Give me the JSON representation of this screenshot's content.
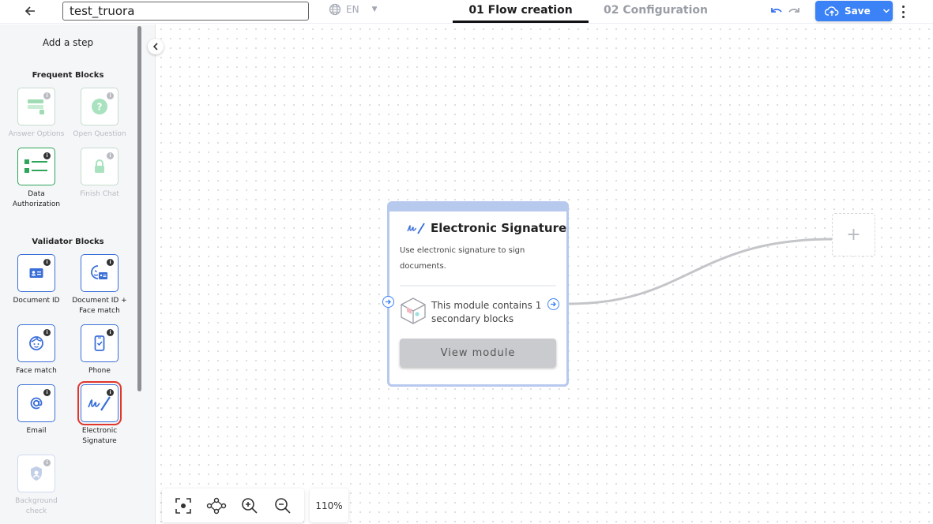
{
  "header": {
    "flow_name": "test_truora",
    "language": "EN",
    "tabs": [
      {
        "label": "01 Flow creation",
        "active": true
      },
      {
        "label": "02 Configuration",
        "active": false
      }
    ],
    "save_label": "Save",
    "accent_color": "#3b82f6"
  },
  "sidebar": {
    "title": "Add a step",
    "sections": [
      {
        "title": "Frequent Blocks",
        "blocks": [
          {
            "label": "Answer Options",
            "enabled": false,
            "icon": "answer-options-icon"
          },
          {
            "label": "Open Question",
            "enabled": false,
            "icon": "question-icon"
          },
          {
            "label": "Data Authorization",
            "enabled": true,
            "icon": "checklist-icon"
          },
          {
            "label": "Finish Chat",
            "enabled": false,
            "icon": "lock-icon"
          }
        ]
      },
      {
        "title": "Validator Blocks",
        "blocks": [
          {
            "label": "Document ID",
            "enabled": true,
            "icon": "id-card-icon"
          },
          {
            "label": "Document ID + Face match",
            "enabled": true,
            "icon": "face-id-icon"
          },
          {
            "label": "Face match",
            "enabled": true,
            "icon": "face-icon"
          },
          {
            "label": "Phone",
            "enabled": true,
            "icon": "phone-icon"
          },
          {
            "label": "Email",
            "enabled": true,
            "icon": "at-icon"
          },
          {
            "label": "Electronic Signature",
            "enabled": true,
            "selected": true,
            "icon": "signature-icon"
          },
          {
            "label": "Background check",
            "enabled": false,
            "icon": "shield-icon"
          }
        ]
      }
    ]
  },
  "canvas": {
    "node": {
      "title": "Electronic Signature",
      "description": "Use electronic signature to sign documents.",
      "module_text": "This module contains 1 secondary blocks",
      "button_label": "View module"
    },
    "add_node_label": "+",
    "zoom": "110%"
  }
}
